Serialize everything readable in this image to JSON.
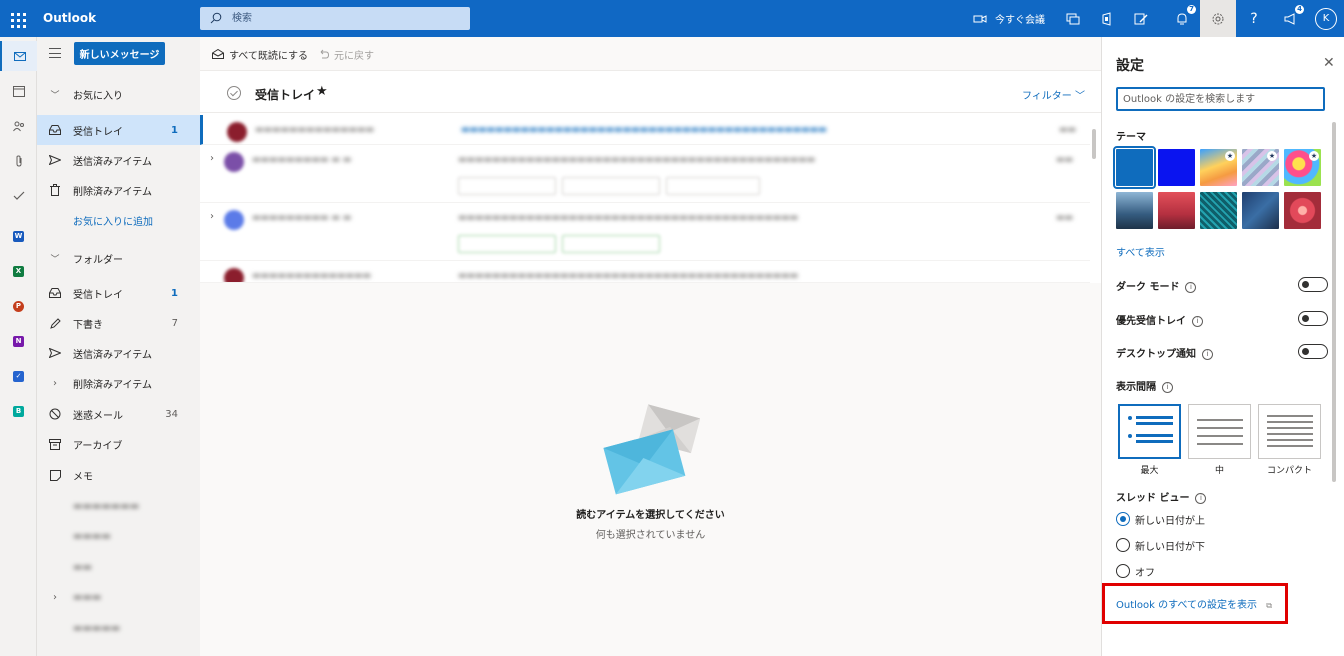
{
  "topbar": {
    "app_name": "Outlook",
    "search_placeholder": "検索",
    "meet_now": "今すぐ会議",
    "notifications_count": "7",
    "whats_new_count": "4",
    "avatar_initial": "K"
  },
  "folders": {
    "new_message": "新しいメッセージ",
    "favorites_header": "お気に入り",
    "favorites": [
      {
        "label": "受信トレイ",
        "count": "1"
      },
      {
        "label": "送信済みアイテム",
        "count": ""
      },
      {
        "label": "削除済みアイテム",
        "count": ""
      },
      {
        "label": "お気に入りに追加",
        "count": ""
      }
    ],
    "folders_header": "フォルダー",
    "items": [
      {
        "label": "受信トレイ",
        "count": "1"
      },
      {
        "label": "下書き",
        "count": "7"
      },
      {
        "label": "送信済みアイテム",
        "count": ""
      },
      {
        "label": "削除済みアイテム",
        "count": ""
      },
      {
        "label": "迷惑メール",
        "count": "34"
      },
      {
        "label": "アーカイブ",
        "count": ""
      },
      {
        "label": "メモ",
        "count": ""
      }
    ]
  },
  "command_bar": {
    "mark_all_read": "すべて既読にする",
    "undo": "元に戻す"
  },
  "message_list": {
    "title": "受信トレイ",
    "filter": "フィルター"
  },
  "reading_pane": {
    "empty_title": "読むアイテムを選択してください",
    "empty_subtitle": "何も選択されていません"
  },
  "settings": {
    "title": "設定",
    "search_placeholder": "Outlook の設定を検索します",
    "theme_label": "テーマ",
    "view_all": "すべて表示",
    "dark_mode": "ダーク モード",
    "focused_inbox": "優先受信トレイ",
    "desktop_notifications": "デスクトップ通知",
    "display_density": "表示間隔",
    "density_options": [
      "最大",
      "中",
      "コンパクト"
    ],
    "conversation_view": "スレッド ビュー",
    "conversation_options": [
      "新しい日付が上",
      "新しい日付が下",
      "オフ"
    ],
    "view_all_settings": "Outlook のすべての設定を表示"
  },
  "colors": {
    "brand": "#1068c4",
    "accent": "#0f6cbd",
    "highlight_box": "#e00000"
  }
}
